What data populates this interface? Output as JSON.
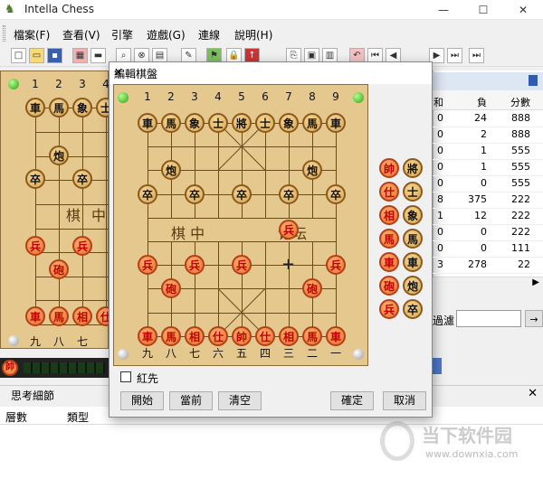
{
  "window": {
    "title": "Intella Chess",
    "minimize": "—",
    "maximize": "☐",
    "close": "✕"
  },
  "menu": [
    "檔案(F)",
    "查看(V)",
    "引擎",
    "遊戲(G)",
    "連線",
    "說明(H)"
  ],
  "main_board": {
    "top_numbers": [
      "1",
      "2",
      "3",
      "4"
    ],
    "bottom_numbers": [
      "九",
      "八",
      "七"
    ],
    "river_left": "棋",
    "river_right": "中"
  },
  "right_panel": {
    "headers": [
      "和",
      "負",
      "分數"
    ],
    "rows": [
      [
        "0",
        "24",
        "888"
      ],
      [
        "0",
        "2",
        "888"
      ],
      [
        "0",
        "1",
        "555"
      ],
      [
        "0",
        "1",
        "555"
      ],
      [
        "0",
        "0",
        "555"
      ],
      [
        "8",
        "375",
        "222"
      ],
      [
        "1",
        "12",
        "222"
      ],
      [
        "0",
        "0",
        "222"
      ],
      [
        "0",
        "0",
        "111"
      ],
      [
        "3",
        "278",
        "22"
      ]
    ],
    "filter_label": "過濾",
    "filter_arrow": "→"
  },
  "bottom": {
    "section_title": "思考細節",
    "columns": [
      "層數",
      "類型"
    ]
  },
  "dialog": {
    "title": "編輯棋盤",
    "close": "✕",
    "top_numbers": [
      "1",
      "2",
      "3",
      "4",
      "5",
      "6",
      "7",
      "8",
      "9"
    ],
    "bottom_numbers": [
      "九",
      "八",
      "七",
      "六",
      "五",
      "四",
      "三",
      "二",
      "一"
    ],
    "river_left": "棋  中",
    "river_right": "论坛",
    "checkbox_label": "紅先",
    "buttons": {
      "start": "開始",
      "current": "當前",
      "clear": "清空",
      "ok": "確定",
      "cancel": "取消"
    },
    "tray": [
      [
        "帥",
        "將"
      ],
      [
        "仕",
        "士"
      ],
      [
        "相",
        "象"
      ],
      [
        "馬",
        "馬"
      ],
      [
        "車",
        "車"
      ],
      [
        "砲",
        "炮"
      ],
      [
        "兵",
        "卒"
      ]
    ]
  },
  "watermark": {
    "name": "当下软件园",
    "url": "www.downxia.com"
  },
  "colors": {
    "board": "#e5c88e",
    "red_piece": "#e8702a",
    "black_piece": "#d8a54e"
  }
}
